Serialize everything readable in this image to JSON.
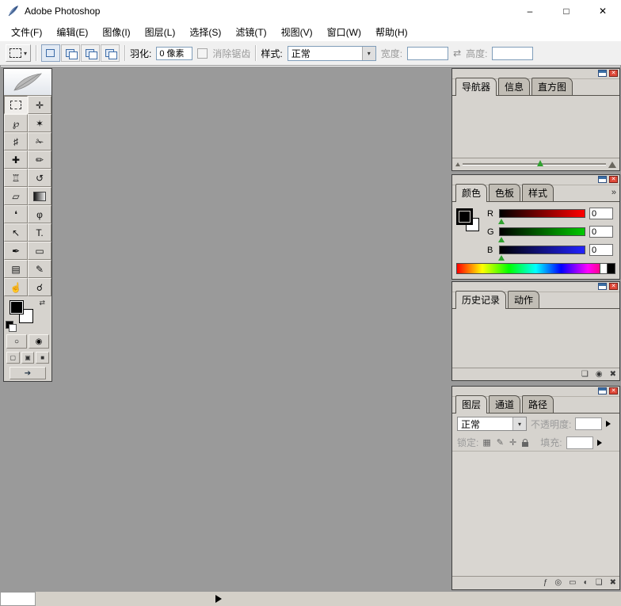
{
  "window": {
    "title": "Adobe Photoshop",
    "controls": {
      "minimize": "–",
      "maximize": "□",
      "close": "✕"
    }
  },
  "menu": {
    "items": [
      "文件(F)",
      "编辑(E)",
      "图像(I)",
      "图层(L)",
      "选择(S)",
      "滤镜(T)",
      "视图(V)",
      "窗口(W)",
      "帮助(H)"
    ]
  },
  "options": {
    "feather_label": "羽化:",
    "feather_value": "0 像素",
    "antialias_label": "消除锯齿",
    "style_label": "样式:",
    "style_value": "正常",
    "width_label": "宽度:",
    "width_value": "",
    "height_label": "高度:",
    "height_value": ""
  },
  "icons": {
    "dropdown_arrow": "▾",
    "swap_dims": "⇄",
    "panel_menu": "»"
  },
  "toolbox": {
    "tools": [
      {
        "name": "rectangular-marquee",
        "glyph": "",
        "selected": true
      },
      {
        "name": "move",
        "glyph": "✛"
      },
      {
        "name": "lasso",
        "glyph": "℘"
      },
      {
        "name": "magic-wand",
        "glyph": "✶"
      },
      {
        "name": "crop",
        "glyph": "♯"
      },
      {
        "name": "slice",
        "glyph": "✁"
      },
      {
        "name": "healing-brush",
        "glyph": "✚"
      },
      {
        "name": "brush",
        "glyph": "✏"
      },
      {
        "name": "clone-stamp",
        "glyph": "♖"
      },
      {
        "name": "history-brush",
        "glyph": "↺"
      },
      {
        "name": "eraser",
        "glyph": "▱"
      },
      {
        "name": "gradient",
        "glyph": ""
      },
      {
        "name": "blur",
        "glyph": "❛"
      },
      {
        "name": "dodge",
        "glyph": "φ"
      },
      {
        "name": "path-selection",
        "glyph": "↖"
      },
      {
        "name": "type",
        "glyph": "T."
      },
      {
        "name": "pen",
        "glyph": "✒"
      },
      {
        "name": "shape",
        "glyph": "▭"
      },
      {
        "name": "notes",
        "glyph": "▤"
      },
      {
        "name": "eyedropper",
        "glyph": "✎"
      },
      {
        "name": "hand",
        "glyph": "☝"
      },
      {
        "name": "zoom",
        "glyph": "☌"
      }
    ],
    "swap_colors_icon": "⇄",
    "standard_mode_icon": "○",
    "quick_mask_icon": "◉",
    "screen_modes": [
      "▢",
      "▣",
      "■"
    ],
    "jump_icon": "➔"
  },
  "panels": {
    "navigator": {
      "tabs": [
        "导航器",
        "信息",
        "直方图"
      ]
    },
    "color": {
      "tabs": [
        "颜色",
        "色板",
        "样式"
      ],
      "channels": [
        {
          "label": "R",
          "value": "0"
        },
        {
          "label": "G",
          "value": "0"
        },
        {
          "label": "B",
          "value": "0"
        }
      ]
    },
    "history": {
      "tabs": [
        "历史记录",
        "动作"
      ],
      "buttons": [
        {
          "name": "new-document-from-state",
          "glyph": "❏"
        },
        {
          "name": "new-snapshot",
          "glyph": "◉"
        },
        {
          "name": "delete-state",
          "glyph": "✖"
        }
      ]
    },
    "layers": {
      "tabs": [
        "图层",
        "通道",
        "路径"
      ],
      "blend_mode": "正常",
      "opacity_label": "不透明度:",
      "lock_label": "锁定:",
      "fill_label": "填充:",
      "buttons": [
        {
          "name": "layer-style",
          "glyph": "ƒ"
        },
        {
          "name": "layer-mask",
          "glyph": "◎"
        },
        {
          "name": "new-group",
          "glyph": "▭"
        },
        {
          "name": "adjustment-layer",
          "glyph": "◐"
        },
        {
          "name": "new-layer",
          "glyph": "❏"
        },
        {
          "name": "delete-layer",
          "glyph": "✖"
        }
      ]
    }
  }
}
